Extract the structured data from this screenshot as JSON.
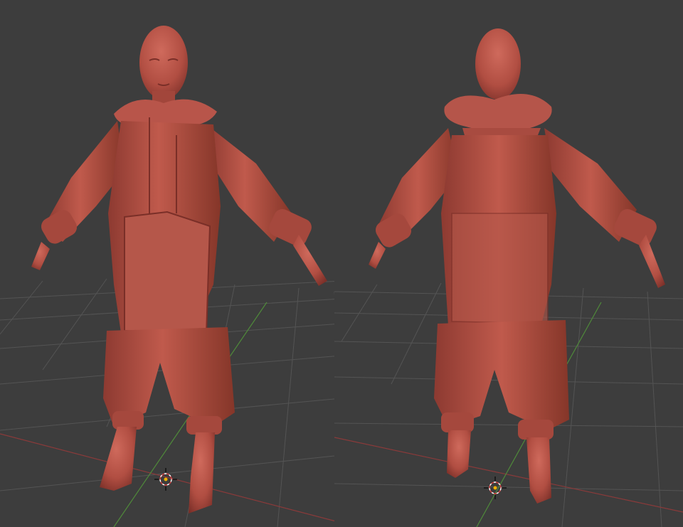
{
  "viewports": [
    {
      "name": "front",
      "view": "front"
    },
    {
      "name": "back",
      "view": "back"
    }
  ],
  "colors": {
    "background": "#3d3d3d",
    "grid": "#545454",
    "axis_x": "#8a3a3a",
    "axis_y": "#4f8a3a",
    "sculpt_material": "#b14e42",
    "sculpt_shadow": "#7a2f28",
    "sculpt_highlight": "#cf6a5c"
  },
  "icons": [
    "3d-cursor-icon"
  ]
}
